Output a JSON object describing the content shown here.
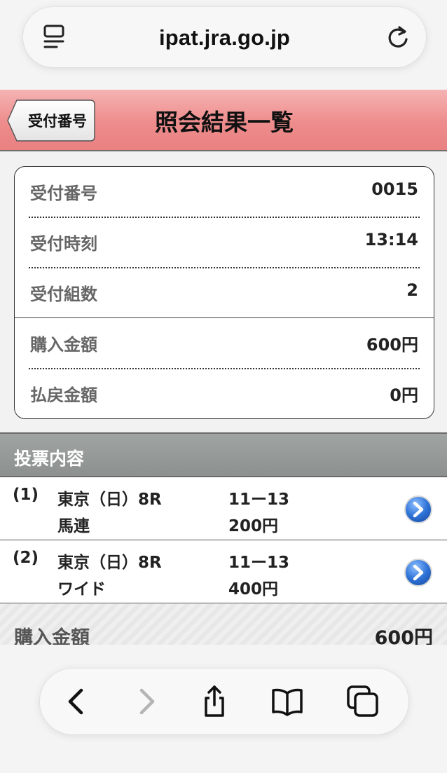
{
  "browser": {
    "url": "ipat.jra.go.jp",
    "icons": {
      "left": "reader-icon",
      "right": "reload-icon"
    }
  },
  "header": {
    "back_label": "受付番号",
    "title": "照会結果一覧",
    "colors": {
      "top": "#f5b3b3",
      "bottom": "#e98181"
    }
  },
  "summary": {
    "rows": [
      {
        "label": "受付番号",
        "value": "0015"
      },
      {
        "label": "受付時刻",
        "value": "13:14"
      },
      {
        "label": "受付組数",
        "value": "2"
      },
      {
        "label": "購入金額",
        "value": "600円"
      },
      {
        "label": "払戻金額",
        "value": "0円"
      }
    ]
  },
  "bets": {
    "section_title": "投票内容",
    "items": [
      {
        "num": "(1)",
        "race": "東京（日）8R",
        "type": "馬連",
        "combo": "11ー13",
        "amount": "200円"
      },
      {
        "num": "(2)",
        "race": "東京（日）8R",
        "type": "ワイド",
        "combo": "11ー13",
        "amount": "400円"
      }
    ]
  },
  "total": {
    "label": "購入金額",
    "value": "600円"
  },
  "toolbar": {
    "buttons": [
      "back-icon",
      "forward-icon",
      "share-icon",
      "bookmarks-icon",
      "tabs-icon"
    ]
  }
}
